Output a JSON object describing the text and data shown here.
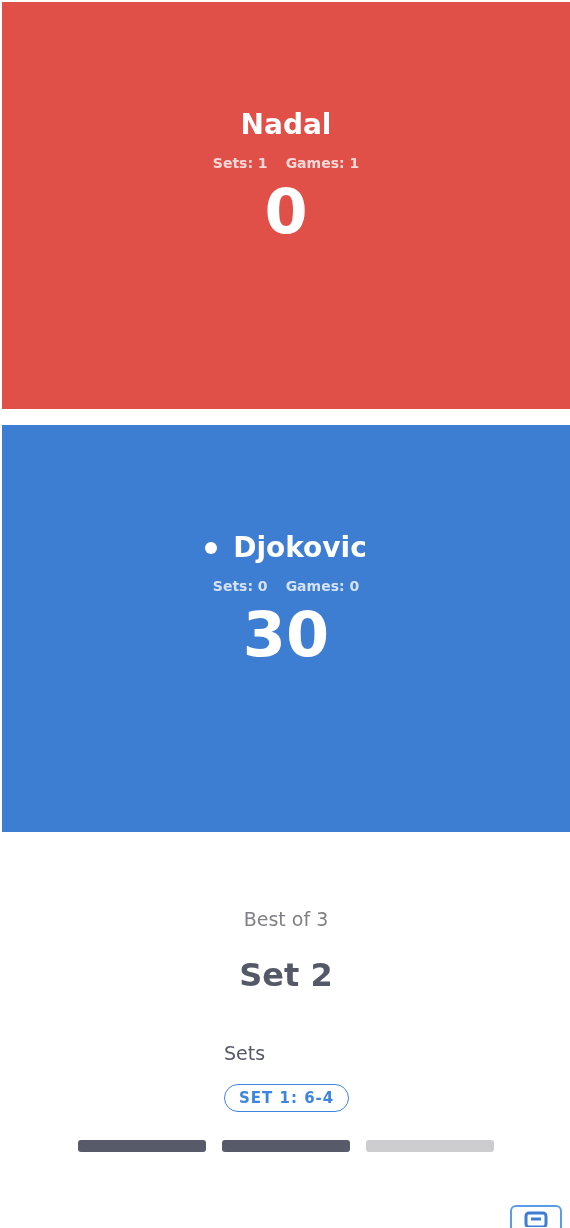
{
  "players": [
    {
      "name": "Nadal",
      "serving": false,
      "sets": "Sets: 1",
      "games": "Games: 1",
      "points": "0",
      "color": "#e05048"
    },
    {
      "name": "Djokovic",
      "serving": true,
      "sets": "Sets: 0",
      "games": "Games: 0",
      "points": "30",
      "color": "#3d7dd2"
    }
  ],
  "match": {
    "format": "Best of 3",
    "current_set": "Set 2"
  },
  "sets_section": {
    "title": "Sets",
    "results": [
      "SET 1: 6-4"
    ],
    "progress": [
      {
        "done": true
      },
      {
        "done": true
      },
      {
        "done": false
      }
    ]
  }
}
